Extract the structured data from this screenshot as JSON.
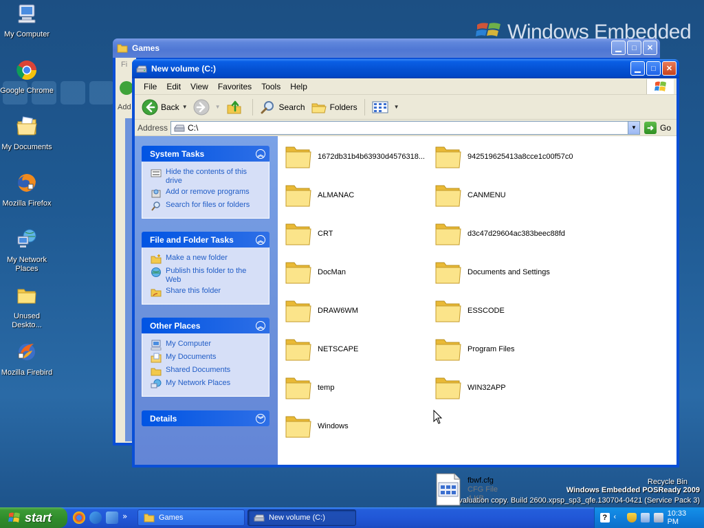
{
  "desktop": {
    "icons": [
      {
        "label": "My Computer"
      },
      {
        "label": "Google Chrome"
      },
      {
        "label": "My Documents"
      },
      {
        "label": "Mozilla Firefox"
      },
      {
        "label": "My Network Places"
      },
      {
        "label": "Unused Deskto..."
      },
      {
        "label": "Mozilla Firebird"
      }
    ],
    "recycle_bin": "Recycle Bin",
    "os_name": "Windows Embedded POSReady 2009",
    "build_info": "Evaluation copy. Build 2600.xpsp_sp3_qfe.130704-0421 (Service Pack 3)",
    "brand_text": "Windows Embedded"
  },
  "back_window": {
    "title": "Games",
    "menu_stub": "Fi",
    "addr_stub": "Add"
  },
  "explorer": {
    "title": "New volume (C:)",
    "menu": [
      "File",
      "Edit",
      "View",
      "Favorites",
      "Tools",
      "Help"
    ],
    "toolbar": {
      "back_label": "Back",
      "search_label": "Search",
      "folders_label": "Folders"
    },
    "address": {
      "label": "Address",
      "value": "C:\\",
      "go_label": "Go"
    },
    "panels": {
      "system_tasks": {
        "title": "System Tasks",
        "items": [
          "Hide the contents of this drive",
          "Add or remove programs",
          "Search for files or folders"
        ]
      },
      "file_folder_tasks": {
        "title": "File and Folder Tasks",
        "items": [
          "Make a new folder",
          "Publish this folder to the Web",
          "Share this folder"
        ]
      },
      "other_places": {
        "title": "Other Places",
        "items": [
          "My Computer",
          "My Documents",
          "Shared Documents",
          "My Network Places"
        ]
      },
      "details": {
        "title": "Details"
      }
    },
    "items": [
      {
        "name": "1672db31b4b63930d4576318..."
      },
      {
        "name": "942519625413a8cce1c00f57c0"
      },
      {
        "name": "ALMANAC"
      },
      {
        "name": "CANMENU"
      },
      {
        "name": "CRT"
      },
      {
        "name": "d3c47d29604ac383beec88fd"
      },
      {
        "name": "DocMan"
      },
      {
        "name": "Documents and Settings"
      },
      {
        "name": "DRAW6WM"
      },
      {
        "name": "ESSCODE"
      },
      {
        "name": "NETSCAPE"
      },
      {
        "name": "Program Files"
      },
      {
        "name": "temp"
      },
      {
        "name": "WIN32APP"
      },
      {
        "name": "Windows"
      }
    ],
    "file": {
      "name": "fbwf.cfg",
      "type": "CFG File",
      "size": "4 KB"
    }
  },
  "taskbar": {
    "start_label": "start",
    "buttons": [
      {
        "label": "Games"
      },
      {
        "label": "New volume (C:)"
      }
    ],
    "clock": "10:33 PM"
  },
  "colors": {
    "titlebar_blue": "#0552d3",
    "taskpane_blue": "#6d93dc",
    "start_green": "#3c9a35",
    "link_blue": "#215dc6"
  }
}
